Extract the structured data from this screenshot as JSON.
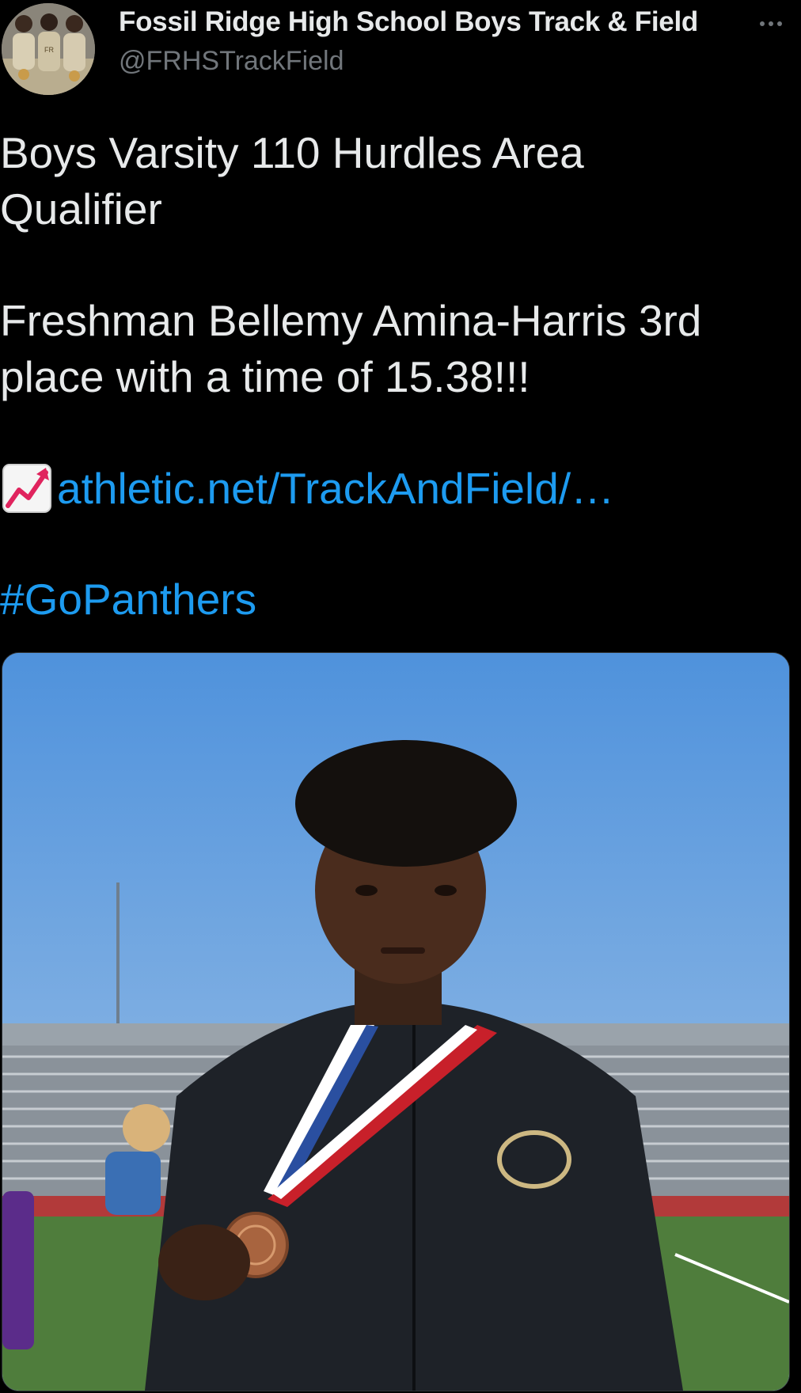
{
  "tweet": {
    "author": {
      "display_name": "Fossil Ridge High School Boys Track & Field",
      "handle": "@FRHSTrackField",
      "avatar": "team-photo-avatar"
    },
    "more_icon": "more-horizontal-icon",
    "text_lines": [
      "Boys Varsity 110 Hurdles Area",
      "Qualifier",
      "Freshman Bellemy Amina-Harris 3rd",
      "place with a time of 15.38!!!"
    ],
    "link": {
      "emoji": "chart-increasing-emoji",
      "text": "athletic.net/TrackAndField/…"
    },
    "hashtag": "#GoPanthers",
    "media": {
      "type": "photo",
      "description_icon": "athlete-medal-photo"
    }
  },
  "colors": {
    "background": "#000000",
    "text": "#e7e9ea",
    "secondary_text": "#71767b",
    "link": "#1d9bf0"
  }
}
